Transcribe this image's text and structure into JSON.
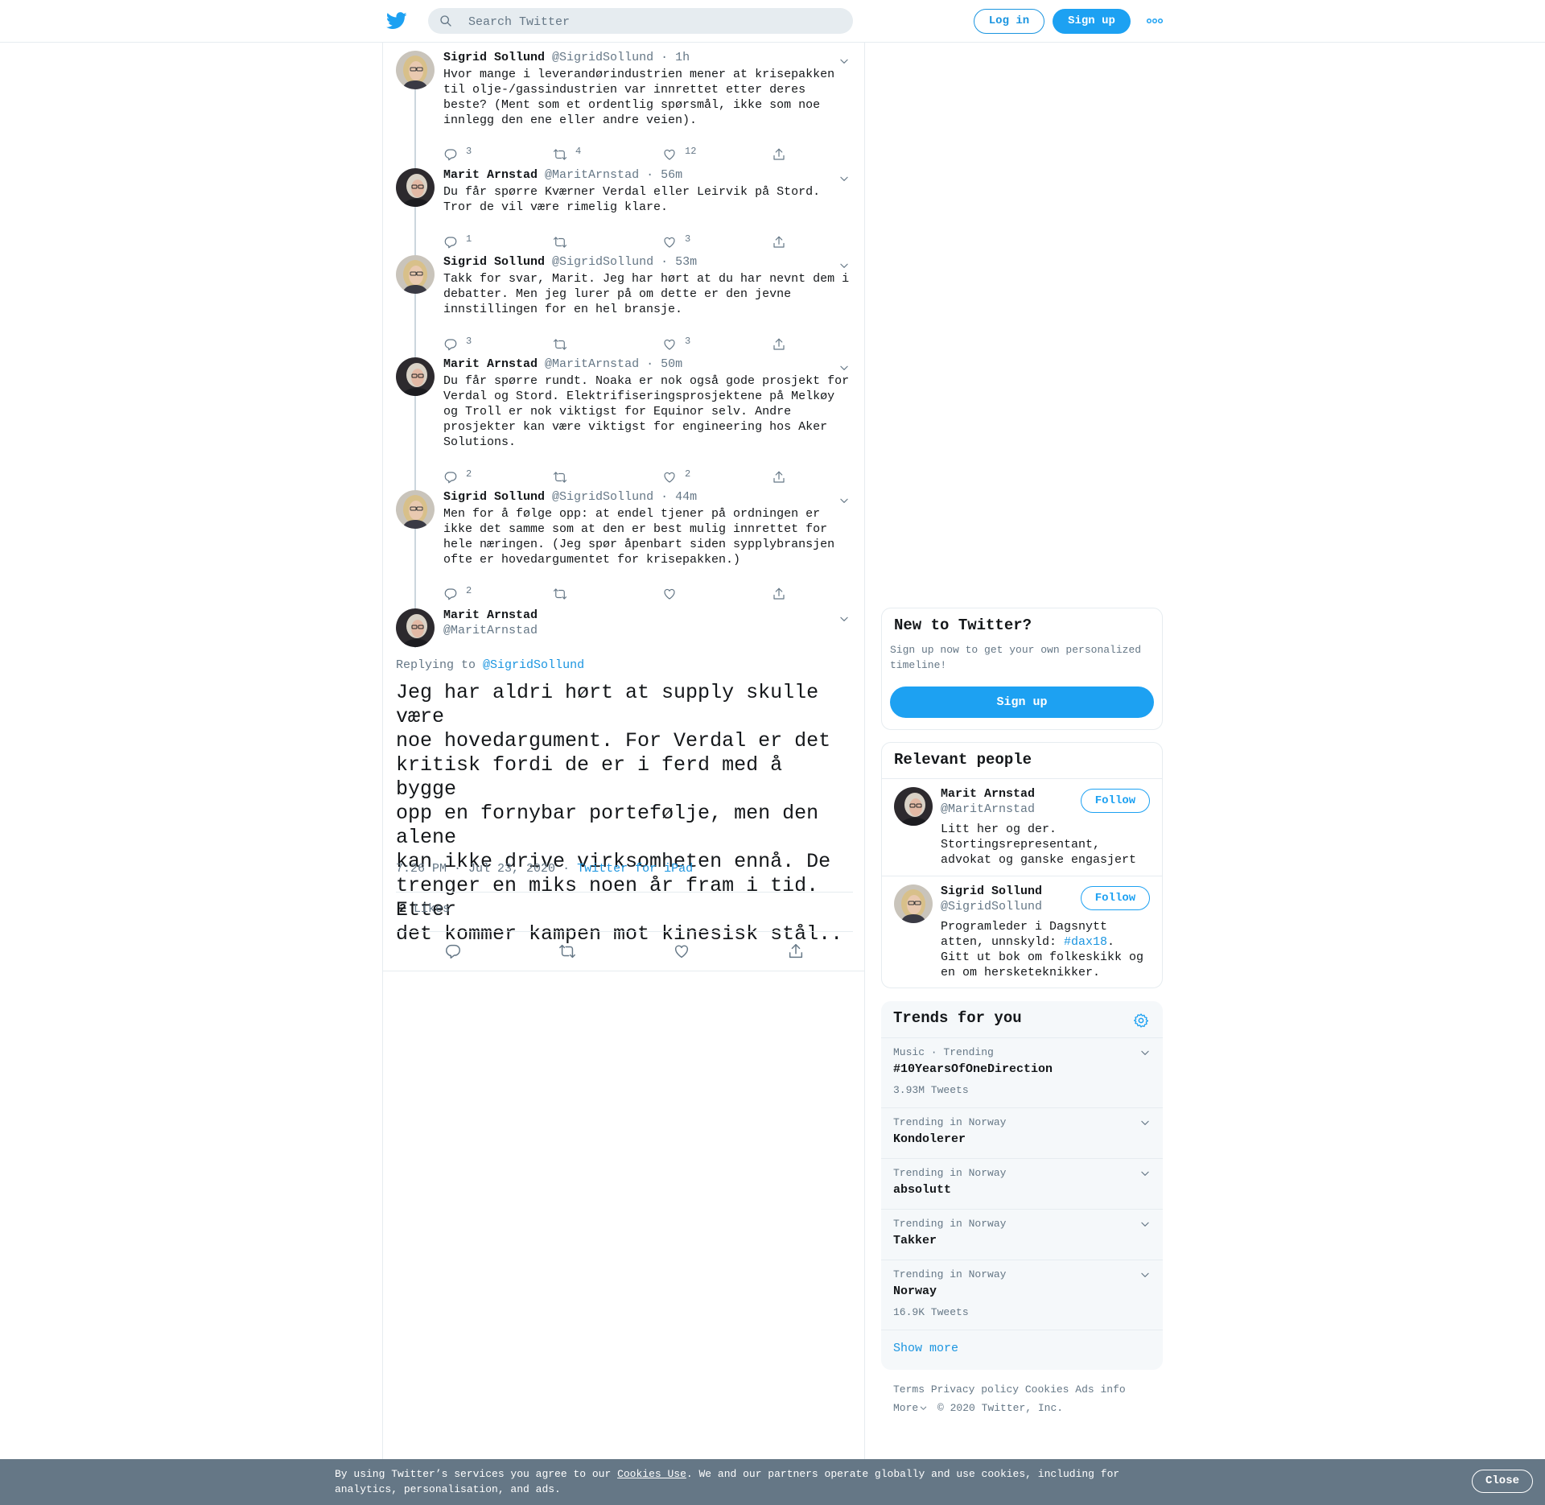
{
  "header": {
    "search_placeholder": "Search Twitter",
    "login": "Log in",
    "signup": "Sign up"
  },
  "thread": [
    {
      "name": "Sigrid Sollund",
      "handle": "@SigridSollund",
      "time": "· 1h",
      "text": "Hvor mange i leverandørindustrien mener at krisepakken\ntil olje-/gassindustrien var innrettet etter deres\nbeste? (Ment som et ordentlig spørsmål, ikke som noe\ninnlegg den ene eller andre veien).",
      "replies": "3",
      "retweets": "4",
      "likes": "12",
      "avatar": "sigrid"
    },
    {
      "name": "Marit Arnstad",
      "handle": "@MaritArnstad",
      "time": "· 56m",
      "text": "Du får spørre Kværner Verdal eller Leirvik på Stord.\nTror de vil være rimelig klare.",
      "replies": "1",
      "retweets": "",
      "likes": "3",
      "avatar": "marit"
    },
    {
      "name": "Sigrid Sollund",
      "handle": "@SigridSollund",
      "time": "· 53m",
      "text": "Takk for svar, Marit. Jeg har hørt at du har nevnt dem i\ndebatter. Men jeg lurer på om dette er den jevne\ninnstillingen for en hel bransje.",
      "replies": "3",
      "retweets": "",
      "likes": "3",
      "avatar": "sigrid"
    },
    {
      "name": "Marit Arnstad",
      "handle": "@MaritArnstad",
      "time": "· 50m",
      "text": "Du får spørre rundt. Noaka er nok også gode prosjekt for\nVerdal og Stord. Elektrifiseringsprosjektene på Melkøy\nog Troll er nok viktigst for Equinor selv. Andre\nprosjekter kan være viktigst for engineering hos Aker\nSolutions.",
      "replies": "2",
      "retweets": "",
      "likes": "2",
      "avatar": "marit"
    },
    {
      "name": "Sigrid Sollund",
      "handle": "@SigridSollund",
      "time": "· 44m",
      "text": "Men for å følge opp: at endel tjener på ordningen er\nikke det samme som at den er best mulig innrettet for\nhele næringen. (Jeg spør åpenbart siden sypplybransjen\nofte er hovedargumentet for krisepakken.)",
      "replies": "2",
      "retweets": "",
      "likes": "",
      "avatar": "sigrid"
    }
  ],
  "main_tweet": {
    "name": "Marit Arnstad",
    "handle": "@MaritArnstad",
    "replying_label": "Replying to",
    "replying_to": "@SigridSollund",
    "text": "Jeg har aldri hørt at supply skulle være\nnoe hovedargument. For Verdal er det\nkritisk fordi de er i ferd med å bygge\nopp en fornybar portefølje, men den alene\nkan ikke drive virksomheten ennå. De\ntrenger en miks noen år fram i tid. Etter\ndet kommer kampen mot kinesisk stål..",
    "timestamp": "7:26 PM · Jul 23, 2020",
    "source_sep": "·",
    "source": "Twitter for iPad",
    "likes_count": "2",
    "likes_label": "Likes"
  },
  "new_to_twitter": {
    "title": "New to Twitter?",
    "desc": "Sign up now to get your own personalized\ntimeline!",
    "button": "Sign up"
  },
  "relevant": {
    "title": "Relevant people",
    "people": [
      {
        "name": "Marit Arnstad",
        "handle": "@MaritArnstad",
        "bio": "Litt her og der.\nStortingsrepresentant,\nadvokat og ganske engasjert",
        "follow": "Follow"
      },
      {
        "name": "Sigrid Sollund",
        "handle": "@SigridSollund",
        "bio_1": "Programleder i Dagsnytt\natten, unnskyld: ",
        "hashtag": "#dax18",
        "bio_2": ".\nGitt ut bok om folkeskikk og\nen om hersketeknikker.",
        "follow": "Follow"
      }
    ]
  },
  "trends": {
    "title": "Trends for you",
    "items": [
      {
        "context": "Music · Trending",
        "title": "#10YearsOfOneDirection",
        "count": "3.93M Tweets"
      },
      {
        "context": "Trending in Norway",
        "title": "Kondolerer",
        "count": ""
      },
      {
        "context": "Trending in Norway",
        "title": "absolutt",
        "count": ""
      },
      {
        "context": "Trending in Norway",
        "title": "Takker",
        "count": ""
      },
      {
        "context": "Trending in Norway",
        "title": "Norway",
        "count": "16.9K Tweets"
      }
    ],
    "show_more": "Show more"
  },
  "footer": {
    "terms": "Terms",
    "privacy": "Privacy policy",
    "cookies": "Cookies",
    "ads": "Ads info",
    "more": "More",
    "copyright": "© 2020 Twitter, Inc."
  },
  "cookie_bar": {
    "text_1": "By using Twitter’s services you agree to our ",
    "link": "Cookies Use",
    "text_2": ". We and our partners operate globally and use cookies, including for\nanalytics, personalisation, and ads.",
    "close": "Close"
  },
  "colors": {
    "accent": "#1da1f2",
    "link": "#1b95e0",
    "muted": "#657786",
    "cookie_bg": "#657786"
  }
}
